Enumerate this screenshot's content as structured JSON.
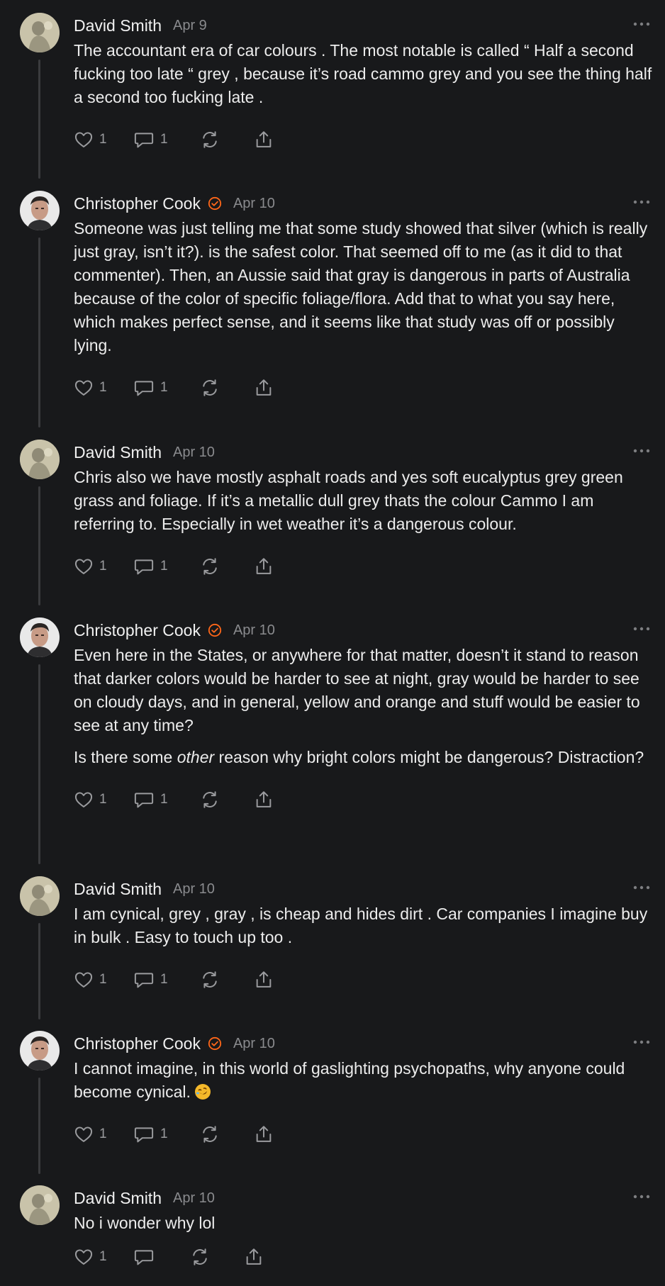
{
  "comments": [
    {
      "author": "David Smith",
      "avatar": "statue-avatar",
      "verified": false,
      "date": "Apr 9",
      "paragraphs": [
        "The accountant era of car colours . The most notable is called “ Half a second fucking too late “ grey , because it’s road cammo grey and you see the thing half a second too fucking late ."
      ],
      "likes": "1",
      "replies": "1"
    },
    {
      "author": "Christopher Cook",
      "avatar": "portrait-avatar",
      "verified": true,
      "date": "Apr 10",
      "paragraphs": [
        "Someone was just telling me that some study showed that silver (which is really just gray, isn’t it?). is the safest color. That seemed off to me (as it did to that commenter). Then, an Aussie said that gray is dangerous in parts of Australia because of the color of specific foliage/flora. Add that to what you say here, which makes perfect sense, and it seems like that study was off or possibly lying."
      ],
      "likes": "1",
      "replies": "1"
    },
    {
      "author": "David Smith",
      "avatar": "statue-avatar",
      "verified": false,
      "date": "Apr 10",
      "paragraphs": [
        "Chris also we have mostly asphalt roads and yes soft eucalyptus grey green grass and foliage. If it’s a metallic dull grey thats the colour Cammo I am referring to. Especially in wet weather it’s a dangerous colour."
      ],
      "likes": "1",
      "replies": "1"
    },
    {
      "author": "Christopher Cook",
      "avatar": "portrait-avatar",
      "verified": true,
      "date": "Apr 10",
      "paragraphs": [
        "Even here in the States, or anywhere for that matter, doesn’t it stand to reason that darker colors would be harder to see at night, gray would be harder to see on cloudy days, and in general, yellow and orange and stuff would be easier to see at any time?"
      ],
      "paragraph2": {
        "before": "Is there some ",
        "emphasis": "other",
        "after": " reason why bright colors might be dangerous? Distraction?"
      },
      "likes": "1",
      "replies": "1"
    },
    {
      "author": "David Smith",
      "avatar": "statue-avatar",
      "verified": false,
      "date": "Apr 10",
      "paragraphs": [
        "I am cynical, grey , gray , is cheap and hides dirt . Car companies I imagine buy in bulk . Easy to touch up too ."
      ],
      "likes": "1",
      "replies": "1"
    },
    {
      "author": "Christopher Cook",
      "avatar": "portrait-avatar",
      "verified": true,
      "date": "Apr 10",
      "paragraphs": [
        "I cannot imagine, in this world of gaslighting psychopaths, why anyone could become cynical."
      ],
      "emoji": "rolling-on-floor-laughing-emoji",
      "likes": "1",
      "replies": "1"
    },
    {
      "author": "David Smith",
      "avatar": "statue-avatar",
      "verified": false,
      "date": "Apr 10",
      "paragraphs": [
        "No i wonder why lol"
      ],
      "likes": "1",
      "replies": ""
    }
  ],
  "icons": {
    "like": "heart-icon",
    "reply": "speech-bubble-icon",
    "restack": "restack-icon",
    "share": "share-icon",
    "more": "more-dots-icon",
    "verified": "verified-check-icon"
  },
  "colors": {
    "background": "#18191b",
    "text": "#ececec",
    "muted": "#8a8b8e",
    "verified_accent": "#ff6719",
    "thread_line": "#3a3b3e"
  }
}
